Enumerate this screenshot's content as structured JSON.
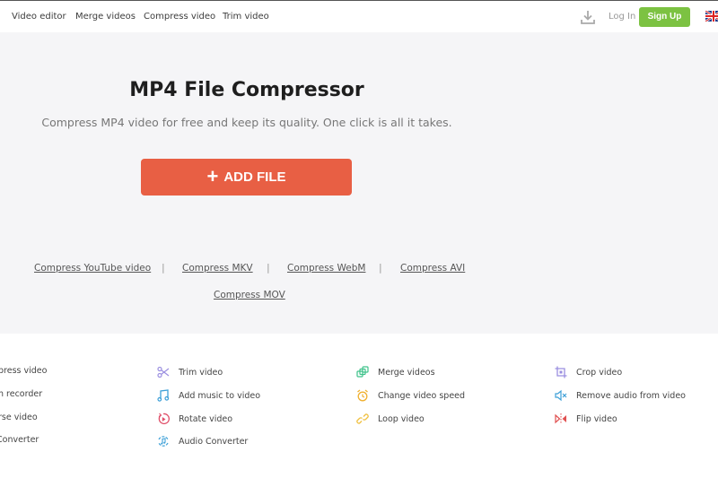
{
  "nav": {
    "items": [
      {
        "label": "Video editor"
      },
      {
        "label": "Merge videos"
      },
      {
        "label": "Compress video"
      },
      {
        "label": "Trim video"
      }
    ],
    "download_icon": "download-icon",
    "login_label": "Log In",
    "signup_label": "Sign Up",
    "language_icon": "uk-flag-icon"
  },
  "hero": {
    "title": "MP4 File Compressor",
    "subtitle": "Compress MP4 video for free and keep its quality. One click is all it takes.",
    "add_file_icon": "plus-icon",
    "add_file_label": "ADD FILE",
    "format_links": [
      {
        "label": "Compress YouTube video"
      },
      {
        "label": "Compress MKV"
      },
      {
        "label": "Compress WebM"
      },
      {
        "label": "Compress AVI"
      },
      {
        "label": "Compress MOV"
      }
    ],
    "separator": "|"
  },
  "tools": {
    "columns": [
      [
        {
          "label": "press video",
          "icon": ""
        },
        {
          "label": "n recorder",
          "icon": ""
        },
        {
          "label": "rse video",
          "icon": ""
        },
        {
          "label": " Converter",
          "icon": ""
        }
      ],
      [
        {
          "label": "Trim video",
          "icon": "scissors-icon",
          "color": "#9b8fe0"
        },
        {
          "label": "Add music to video",
          "icon": "music-note-icon",
          "color": "#3ea0d8"
        },
        {
          "label": "Rotate video",
          "icon": "rotate-icon",
          "color": "#e0506a"
        },
        {
          "label": "Audio Converter",
          "icon": "audio-convert-icon",
          "color": "#3ea0d8"
        }
      ],
      [
        {
          "label": "Merge videos",
          "icon": "merge-icon",
          "color": "#3ec28a"
        },
        {
          "label": "Change video speed",
          "icon": "alarm-clock-icon",
          "color": "#f0b030"
        },
        {
          "label": "Loop video",
          "icon": "link-icon",
          "color": "#f0c040"
        }
      ],
      [
        {
          "label": "Crop video",
          "icon": "crop-icon",
          "color": "#9b8fe0"
        },
        {
          "label": "Remove audio from video",
          "icon": "mute-icon",
          "color": "#3ea0d8"
        },
        {
          "label": "Flip video",
          "icon": "flip-icon",
          "color": "#e05050"
        }
      ]
    ]
  },
  "colors": {
    "accent_button": "#e85f44",
    "signup_button": "#7cc242",
    "hero_background": "#f5f5f7"
  }
}
